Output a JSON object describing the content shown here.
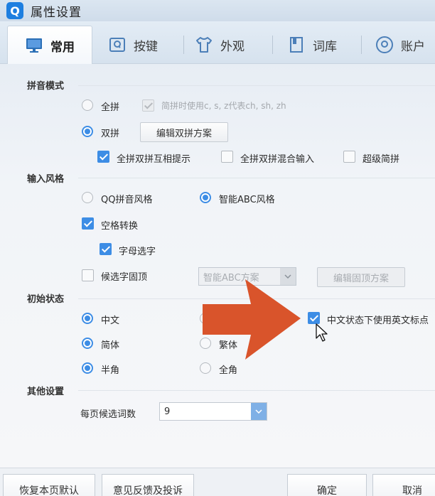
{
  "window": {
    "title": "属性设置",
    "app_icon_letter": "Q"
  },
  "tabs": [
    {
      "label": "常用",
      "icon": "monitor-icon",
      "active": true
    },
    {
      "label": "按键",
      "icon": "keyboard-key-icon"
    },
    {
      "label": "外观",
      "icon": "tshirt-icon"
    },
    {
      "label": "词库",
      "icon": "book-icon"
    },
    {
      "label": "账户",
      "icon": "user-icon"
    }
  ],
  "pinyin_mode": {
    "title": "拼音模式",
    "full_pinyin": "全拼",
    "abbrev_option": "简拼时使用c, s, z代表ch, sh, zh",
    "double_pinyin": "双拼",
    "edit_double_button": "编辑双拼方案",
    "hint_option": "全拼双拼互相提示",
    "mix_option": "全拼双拼混合输入",
    "super_abbrev": "超级简拼"
  },
  "input_style": {
    "title": "输入风格",
    "qq_style": "QQ拼音风格",
    "abc_style": "智能ABC风格",
    "space_convert": "空格转换",
    "letter_select": "字母选字",
    "fix_top": "候选字固顶",
    "fix_top_scheme": "智能ABC方案",
    "edit_fix_button": "编辑固顶方案"
  },
  "initial_state": {
    "title": "初始状态",
    "chinese": "中文",
    "english_punct": "中文状态下使用英文标点",
    "simplified": "简体",
    "traditional": "繁体",
    "half_width": "半角",
    "full_width": "全角"
  },
  "other": {
    "title": "其他设置",
    "candidates_label": "每页候选词数",
    "candidates_value": "9"
  },
  "footer": {
    "restore": "恢复本页默认",
    "feedback": "意见反馈及投诉",
    "ok": "确定",
    "cancel": "取消"
  },
  "colors": {
    "accent": "#3d8de5",
    "arrow": "#d9542b"
  }
}
